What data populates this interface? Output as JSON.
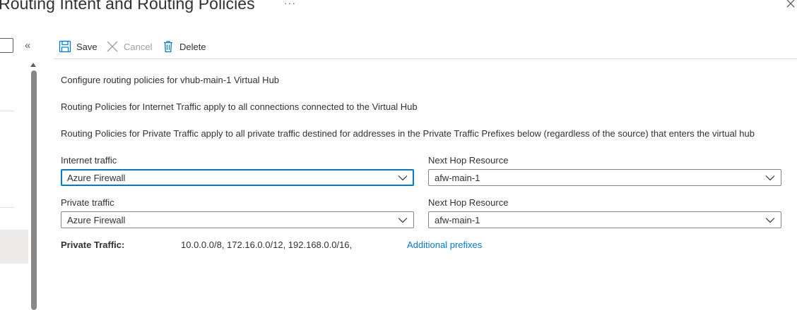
{
  "header": {
    "title": "Routing Intent and Routing Policies",
    "more_label": "···"
  },
  "left_nav": {
    "collapse_label": "«"
  },
  "toolbar": {
    "save_label": "Save",
    "cancel_label": "Cancel",
    "delete_label": "Delete"
  },
  "content": {
    "line1": "Configure routing policies for vhub-main-1 Virtual Hub",
    "line2": "Routing Policies for Internet Traffic apply to all connections connected to the Virtual Hub",
    "line3": "Routing Policies for Private Traffic apply to all private traffic destined for addresses in the Private Traffic Prefixes below (regardless of the source) that enters the virtual hub"
  },
  "form": {
    "internet_traffic_label": "Internet traffic",
    "internet_traffic_value": "Azure Firewall",
    "internet_next_hop_label": "Next Hop Resource",
    "internet_next_hop_value": "afw-main-1",
    "private_traffic_label": "Private traffic",
    "private_traffic_value": "Azure Firewall",
    "private_next_hop_label": "Next Hop Resource",
    "private_next_hop_value": "afw-main-1",
    "private_prefixes_label": "Private Traffic:",
    "private_prefixes_value": "10.0.0.0/8, 172.16.0.0/12, 192.168.0.0/16,",
    "additional_prefixes_link": "Additional prefixes"
  },
  "colors": {
    "accent": "#0078d4",
    "text": "#323130",
    "disabled": "#a19f9d",
    "border": "#8a8886"
  },
  "icons": {
    "save": "save-icon",
    "cancel": "cancel-icon",
    "delete": "delete-icon",
    "close": "close-icon",
    "chevron": "chevron-down-icon"
  }
}
